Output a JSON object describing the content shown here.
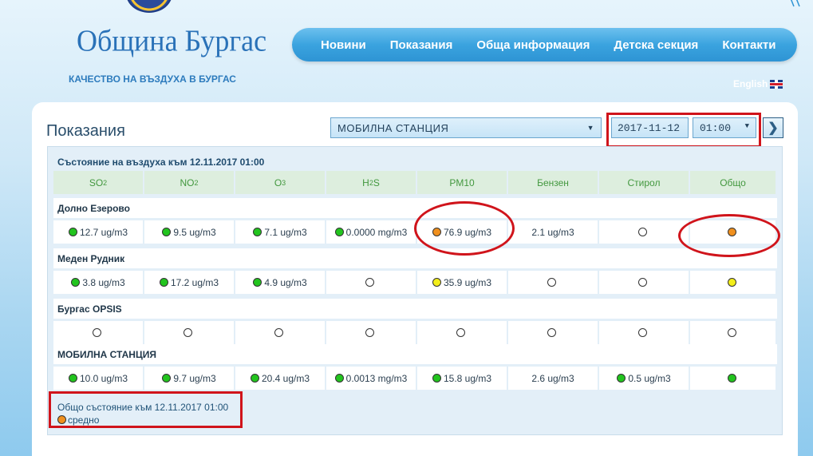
{
  "header": {
    "logo_text": "Община Бургас",
    "tagline": "КАЧЕСТВО НА ВЪЗДУХА В БУРГАС",
    "language_link": "English"
  },
  "nav": {
    "items": [
      "Новини",
      "Показания",
      "Обща информация",
      "Детска секция",
      "Контакти"
    ]
  },
  "panel": {
    "title": "Показания",
    "station_selected": "МОБИЛНА СТАНЦИЯ",
    "date_value": "2017-11-12",
    "time_selected": "01:00",
    "next_symbol": "❯"
  },
  "table": {
    "status_heading": "Състояние на въздуха към 12.11.2017 01:00",
    "columns": [
      {
        "base": "SO",
        "sub": "2",
        "suffix": ""
      },
      {
        "base": "NO",
        "sub": "2",
        "suffix": ""
      },
      {
        "base": "O",
        "sub": "3",
        "suffix": ""
      },
      {
        "base": "H",
        "sub": "2",
        "suffix": "S"
      },
      {
        "base": "PM10",
        "sub": "",
        "suffix": ""
      },
      {
        "base": "Бензен",
        "sub": "",
        "suffix": ""
      },
      {
        "base": "Стирол",
        "sub": "",
        "suffix": ""
      },
      {
        "base": "Общо",
        "sub": "",
        "suffix": ""
      }
    ],
    "stations": [
      {
        "name": "Долно Езерово",
        "cells": [
          {
            "dot": "green",
            "text": "12.7 ug/m3"
          },
          {
            "dot": "green",
            "text": "9.5 ug/m3"
          },
          {
            "dot": "green",
            "text": "7.1 ug/m3"
          },
          {
            "dot": "green",
            "text": "0.0000 mg/m3"
          },
          {
            "dot": "orange",
            "text": "76.9 ug/m3"
          },
          {
            "dot": "",
            "text": "2.1 ug/m3"
          },
          {
            "dot": "empty",
            "text": ""
          },
          {
            "dot": "orange",
            "text": ""
          }
        ]
      },
      {
        "name": "Меден Рудник",
        "cells": [
          {
            "dot": "green",
            "text": "3.8 ug/m3"
          },
          {
            "dot": "green",
            "text": "17.2 ug/m3"
          },
          {
            "dot": "green",
            "text": "4.9 ug/m3"
          },
          {
            "dot": "empty",
            "text": ""
          },
          {
            "dot": "yellow",
            "text": "35.9 ug/m3"
          },
          {
            "dot": "empty",
            "text": ""
          },
          {
            "dot": "empty",
            "text": ""
          },
          {
            "dot": "yellow",
            "text": ""
          }
        ]
      },
      {
        "name": "Бургас OPSIS",
        "cells": [
          {
            "dot": "empty",
            "text": ""
          },
          {
            "dot": "empty",
            "text": ""
          },
          {
            "dot": "empty",
            "text": ""
          },
          {
            "dot": "empty",
            "text": ""
          },
          {
            "dot": "empty",
            "text": ""
          },
          {
            "dot": "empty",
            "text": ""
          },
          {
            "dot": "empty",
            "text": ""
          },
          {
            "dot": "empty",
            "text": ""
          }
        ]
      },
      {
        "name": "МОБИЛНА СТАНЦИЯ",
        "cells": [
          {
            "dot": "green",
            "text": "10.0 ug/m3"
          },
          {
            "dot": "green",
            "text": "9.7 ug/m3"
          },
          {
            "dot": "green",
            "text": "20.4 ug/m3"
          },
          {
            "dot": "green",
            "text": "0.0013 mg/m3"
          },
          {
            "dot": "green",
            "text": "15.8 ug/m3"
          },
          {
            "dot": "",
            "text": "2.6 ug/m3"
          },
          {
            "dot": "green",
            "text": "0.5 ug/m3"
          },
          {
            "dot": "green",
            "text": ""
          }
        ]
      }
    ]
  },
  "summary": {
    "label": "Общо състояние към 12.11.2017 01:00",
    "status_dot": "orange",
    "status_text": "средно"
  },
  "colors": {
    "green": "#22c41e",
    "orange": "#f0901e",
    "yellow": "#f3ee1a",
    "annotation_red": "#d0141b",
    "nav_blue": "#3aa3df"
  }
}
